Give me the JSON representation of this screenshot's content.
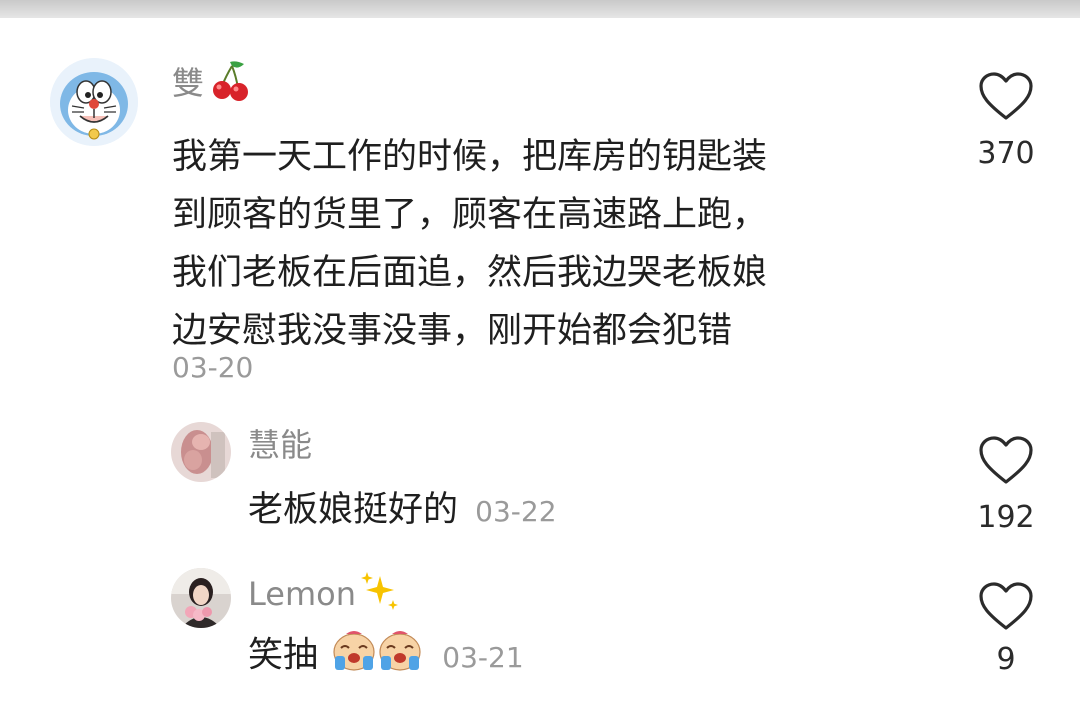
{
  "comments": [
    {
      "username": "雙",
      "username_emoji": "cherry",
      "avatar_icon": "doraemon-avatar-icon",
      "text_lines": [
        "我第一天工作的时候，把库房的钥匙装",
        "到顾客的货里了，顾客在高速路上跑，",
        "我们老板在后面追，然后我边哭老板娘",
        "边安慰我没事没事，刚开始都会犯错"
      ],
      "date": "03-20",
      "likes": "370"
    },
    {
      "username": "慧能",
      "avatar_icon": "pink-flowers-avatar-icon",
      "text": "老板娘挺好的",
      "date": "03-22",
      "likes": "192"
    },
    {
      "username": "Lemon",
      "username_emoji": "sparkles",
      "avatar_icon": "girl-with-flowers-avatar-icon",
      "text": "笑抽",
      "reaction_emoji": "crying-laughing-sticker",
      "reaction_count": 2,
      "date": "03-21",
      "likes": "9"
    }
  ],
  "colors": {
    "text": "#1f1f1f",
    "meta": "#9a9a9a",
    "heart_stroke": "#2b2b2b"
  }
}
